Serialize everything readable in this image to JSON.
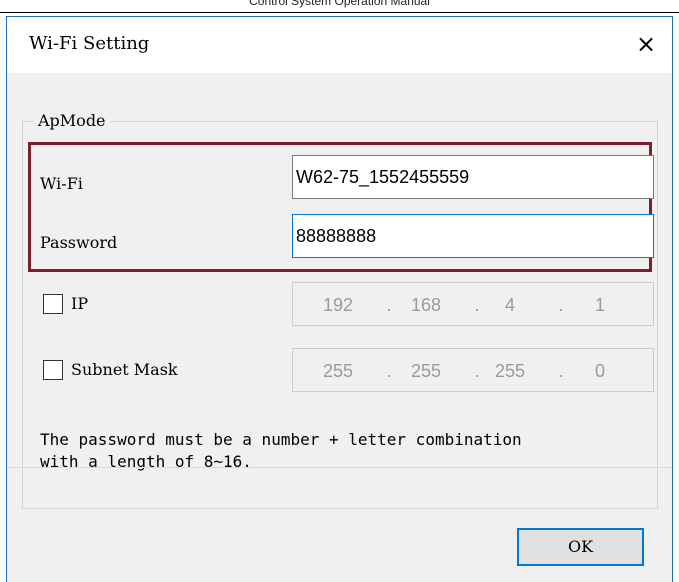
{
  "doc_header": "Control System Operation Manual",
  "dialog": {
    "title": "Wi-Fi Setting",
    "close_label": "×",
    "group_label": "ApMode",
    "wifi": {
      "label": "Wi-Fi",
      "value": "W62-75_1552455559"
    },
    "password": {
      "label": "Password",
      "value": "88888888"
    },
    "ip": {
      "label": "IP",
      "checked": false,
      "octets": [
        "192",
        "168",
        "4",
        "1"
      ]
    },
    "subnet": {
      "label": "Subnet Mask",
      "checked": false,
      "octets": [
        "255",
        "255",
        "255",
        "0"
      ]
    },
    "note": "The password must be a number + letter combination\nwith a length of 8~16.",
    "ok_label": "OK"
  },
  "colors": {
    "highlight_border": "#7b1f2c",
    "focus_border": "#0078d7",
    "window_border": "#1f6fb5"
  },
  "icons": {
    "close": "close-icon",
    "checkbox": "checkbox-unchecked"
  }
}
